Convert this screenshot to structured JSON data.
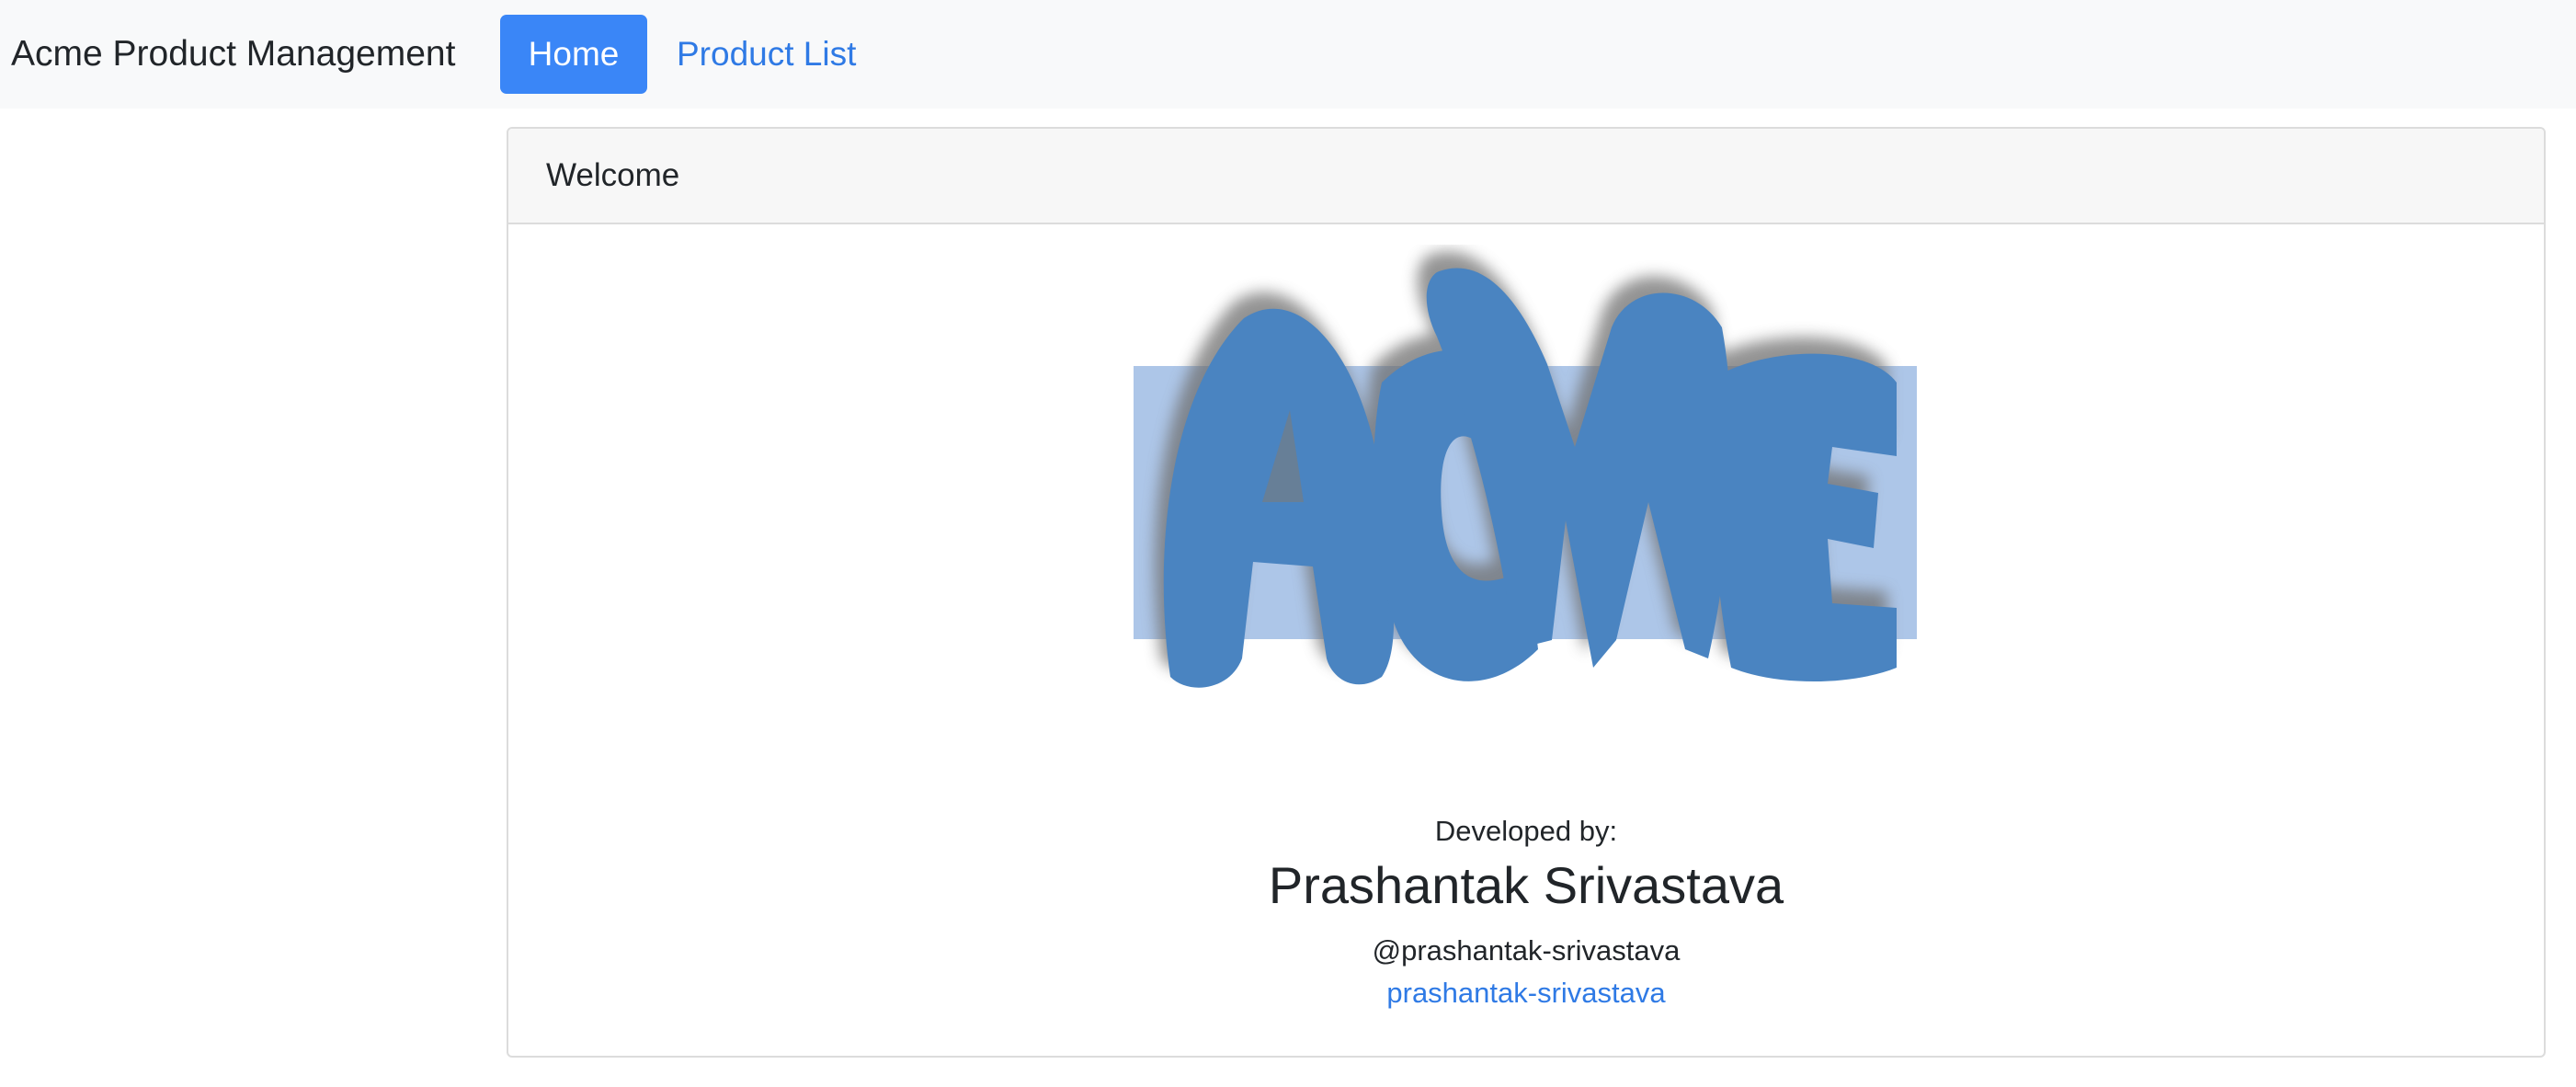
{
  "navbar": {
    "brand": "Acme Product Management",
    "links": [
      {
        "label": "Home",
        "active": true
      },
      {
        "label": "Product List",
        "active": false
      }
    ]
  },
  "card": {
    "header": "Welcome",
    "logo": {
      "text": "AcMe"
    },
    "developed_by_label": "Developed by:",
    "developer_name": "Prashantak Srivastava",
    "handle": "@prashantak-srivastava",
    "profile_link": "prashantak-srivastava"
  },
  "colors": {
    "accent": "#3a86f7",
    "link": "#2f7ae5",
    "navbar_bg": "#f8f9fa",
    "logo_blue": "#4a84c1",
    "logo_box": "#adc6e8"
  }
}
